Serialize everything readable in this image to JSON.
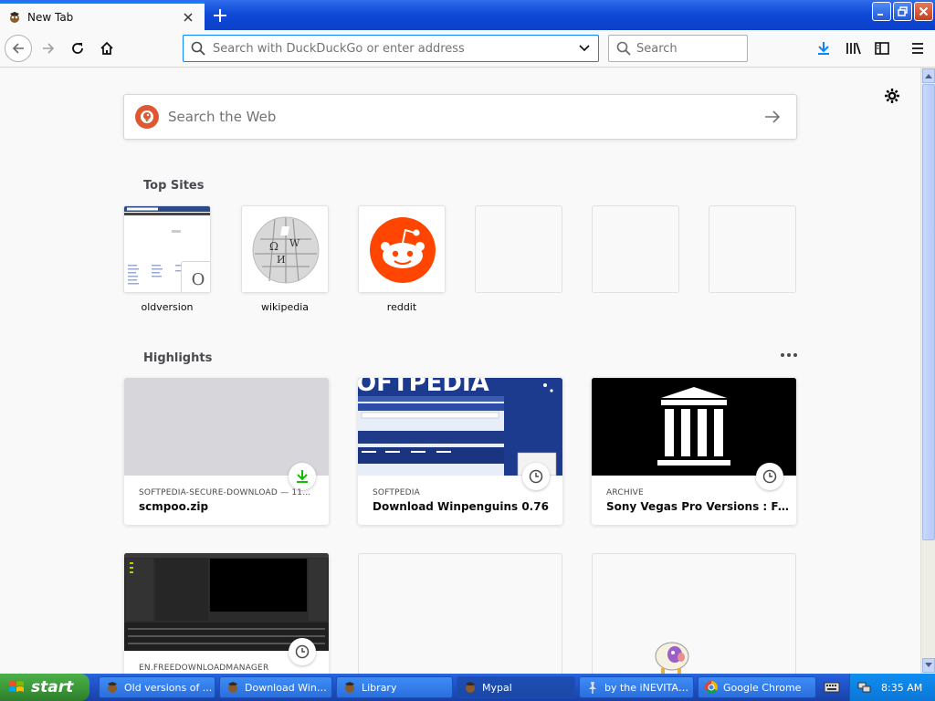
{
  "window": {
    "tab_title": "New Tab",
    "accent": "#0a84ff"
  },
  "toolbar": {
    "url_placeholder": "Search with DuckDuckGo or enter address",
    "search_placeholder": "Search"
  },
  "newtab": {
    "websearch_placeholder": "Search the Web",
    "top_sites_title": "Top Sites",
    "highlights_title": "Highlights",
    "top_sites": [
      {
        "label": "oldversion",
        "icon": "oldversion-thumb"
      },
      {
        "label": "wikipedia",
        "icon": "wikipedia-globe-icon"
      },
      {
        "label": "reddit",
        "icon": "reddit-alien-icon"
      },
      {
        "label": "",
        "icon": ""
      },
      {
        "label": "",
        "icon": ""
      },
      {
        "label": "",
        "icon": ""
      }
    ],
    "highlights": [
      {
        "source": "SOFTPEDIA-SECURE-DOWNLOAD — 116 …",
        "title": "scmpoo.zip",
        "badge": "download-icon"
      },
      {
        "source": "SOFTPEDIA",
        "title": "Download Winpenguins 0.76",
        "badge": "clock-icon"
      },
      {
        "source": "ARCHIVE",
        "title": "Sony Vegas Pro Versions : Free D...",
        "badge": "clock-icon"
      },
      {
        "source": "EN.FREEDOWNLOADMANAGER",
        "title": "",
        "badge": "clock-icon"
      }
    ]
  },
  "taskbar": {
    "start_label": "start",
    "items": [
      {
        "label": "Old versions of ..."
      },
      {
        "label": "Download Winp..."
      },
      {
        "label": "Library"
      },
      {
        "label": "Mypal"
      },
      {
        "label": "by the iNEVITAB..."
      },
      {
        "label": "Google Chrome"
      }
    ],
    "clock": "8:35 AM"
  }
}
